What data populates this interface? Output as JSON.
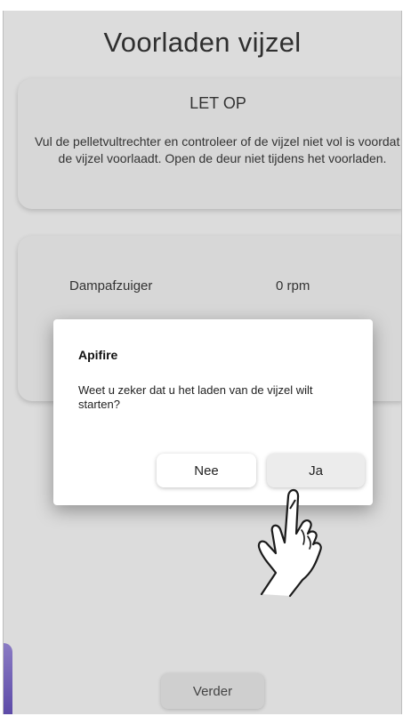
{
  "page": {
    "title": "Voorladen vijzel"
  },
  "warning": {
    "heading": "LET OP",
    "body": "Vul de pelletvultrechter en controleer of de vijzel niet vol is voordat u de vijzel voorlaadt. Open de deur niet tijdens het voorladen."
  },
  "stats": {
    "items": [
      {
        "label": "Dampafzuiger",
        "value": "0 rpm"
      }
    ]
  },
  "footer": {
    "next_label": "Verder"
  },
  "dialog": {
    "title": "Apifire",
    "message": "Weet u zeker dat u het laden van de vijzel wilt starten?",
    "cancel_label": "Nee",
    "confirm_label": "Ja"
  },
  "colors": {
    "screen_background": "#dcdcdc",
    "accent_purple": "#6a58b0"
  },
  "icons": {
    "pointer": "tap-hand-icon"
  }
}
